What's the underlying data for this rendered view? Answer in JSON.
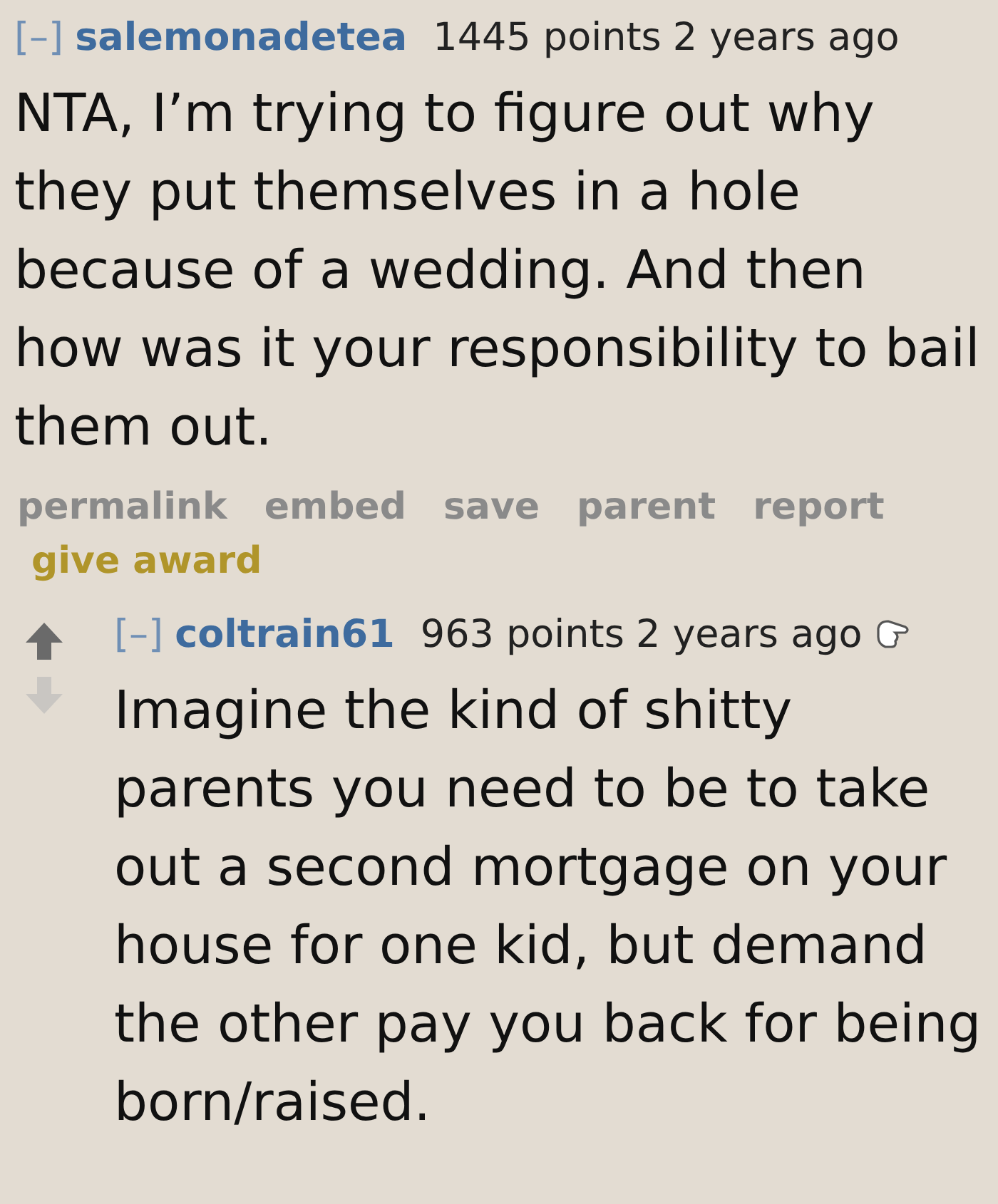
{
  "comments": [
    {
      "collapse": "[–]",
      "author": "salemonadetea",
      "score": "1445 points",
      "time": "2 years ago",
      "body": "NTA, I’m trying to figure out why they put themselves in a hole because of a wedding. And then how was it your responsibility to bail them out.",
      "voting": false,
      "award_icon": false,
      "actions": [
        {
          "label": "permalink",
          "kind": "plain"
        },
        {
          "label": "embed",
          "kind": "plain"
        },
        {
          "label": "save",
          "kind": "plain"
        },
        {
          "label": "parent",
          "kind": "plain"
        },
        {
          "label": "report",
          "kind": "plain"
        },
        {
          "label": "give award",
          "kind": "award"
        }
      ]
    },
    {
      "collapse": "[–]",
      "author": "coltrain61",
      "score": "963 points",
      "time": "2 years ago",
      "body": "Imagine the kind of shitty parents you need to be to take out a second mortgage on your house for one kid, but demand the other pay you back for being born/raised.",
      "voting": true,
      "award_icon": true
    }
  ]
}
